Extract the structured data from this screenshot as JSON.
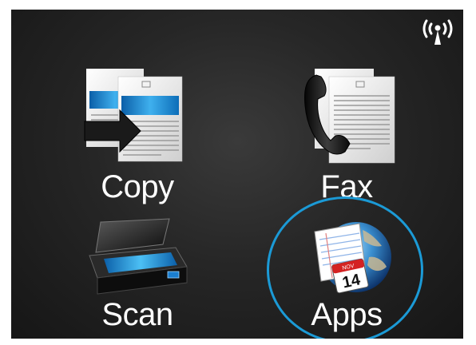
{
  "status_bar": {
    "wireless_icon": "wireless-signal-icon"
  },
  "tiles": [
    {
      "label": "Copy",
      "icon": "copy-icon"
    },
    {
      "label": "Fax",
      "icon": "fax-icon"
    },
    {
      "label": "Scan",
      "icon": "scan-icon"
    },
    {
      "label": "Apps",
      "icon": "apps-icon"
    }
  ],
  "colors": {
    "background": "#222222",
    "label": "#ffffff",
    "highlight_ring": "#1b9ad6"
  }
}
